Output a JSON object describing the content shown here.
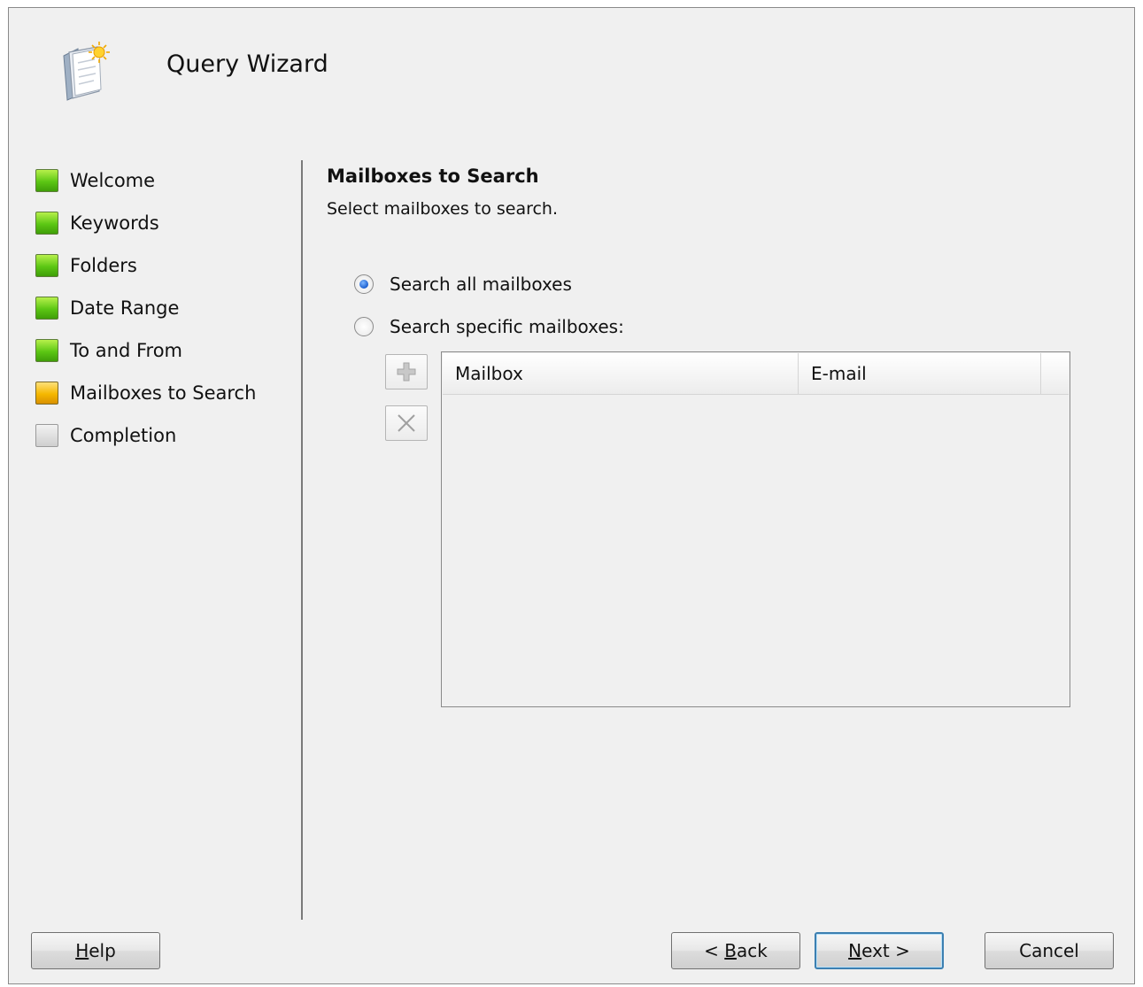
{
  "header": {
    "title": "Query Wizard",
    "icon": "wizard-document-icon"
  },
  "steps": [
    {
      "label": "Welcome",
      "state": "done"
    },
    {
      "label": "Keywords",
      "state": "done"
    },
    {
      "label": "Folders",
      "state": "done"
    },
    {
      "label": "Date Range",
      "state": "done"
    },
    {
      "label": "To and From",
      "state": "done"
    },
    {
      "label": "Mailboxes to Search",
      "state": "current"
    },
    {
      "label": "Completion",
      "state": "pending"
    }
  ],
  "section": {
    "title": "Mailboxes to Search",
    "subtitle": "Select mailboxes to search."
  },
  "options": {
    "all": {
      "label": "Search all mailboxes",
      "selected": true
    },
    "specific": {
      "label": "Search specific mailboxes:",
      "selected": false
    }
  },
  "toolbar": {
    "add_icon": "plus-icon",
    "remove_icon": "close-x-icon"
  },
  "mailbox_list": {
    "columns": [
      "Mailbox",
      "E-mail"
    ],
    "rows": []
  },
  "buttons": {
    "help": {
      "prefix": "",
      "mnemonic": "H",
      "rest": "elp"
    },
    "back": {
      "prefix": "< ",
      "mnemonic": "B",
      "rest": "ack"
    },
    "next": {
      "prefix": "",
      "mnemonic": "N",
      "rest": "ext >"
    },
    "cancel": {
      "label": "Cancel"
    }
  },
  "colors": {
    "step_done": "#5cc714",
    "step_current": "#f5b800",
    "step_pending": "#cfcfcf",
    "default_button_border": "#3c7fb1"
  }
}
